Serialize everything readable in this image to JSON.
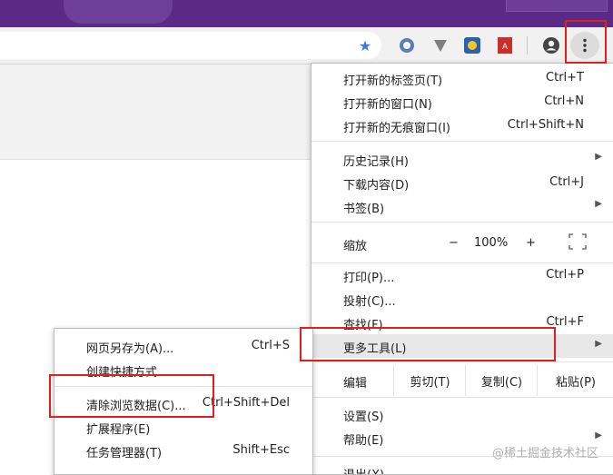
{
  "toolbar": {
    "icons": [
      "star-icon",
      "extension-icon-1",
      "extension-icon-2",
      "extension-icon-3",
      "pdf-icon",
      "account-icon",
      "kebab-menu-icon"
    ],
    "star_color": "#3b78e7"
  },
  "menu": {
    "new_tab": {
      "label": "打开新的标签页(T)",
      "shortcut": "Ctrl+T"
    },
    "new_window": {
      "label": "打开新的窗口(N)",
      "shortcut": "Ctrl+N"
    },
    "new_incognito": {
      "label": "打开新的无痕窗口(I)",
      "shortcut": "Ctrl+Shift+N"
    },
    "history": {
      "label": "历史记录(H)"
    },
    "downloads": {
      "label": "下载内容(D)",
      "shortcut": "Ctrl+J"
    },
    "bookmarks": {
      "label": "书签(B)"
    },
    "zoom": {
      "label": "缩放",
      "minus": "−",
      "value": "100%",
      "plus": "+"
    },
    "print": {
      "label": "打印(P)...",
      "shortcut": "Ctrl+P"
    },
    "cast": {
      "label": "投射(C)..."
    },
    "find": {
      "label": "查找(F)...",
      "shortcut": "Ctrl+F"
    },
    "more_tools": {
      "label": "更多工具(L)"
    },
    "edit": {
      "label": "编辑",
      "cut": "剪切(T)",
      "copy": "复制(C)",
      "paste": "粘贴(P)"
    },
    "settings": {
      "label": "设置(S)"
    },
    "help": {
      "label": "帮助(E)"
    },
    "exit": {
      "label": "退出(X)"
    }
  },
  "submenu": {
    "save_page": {
      "label": "网页另存为(A)...",
      "shortcut": "Ctrl+S"
    },
    "create_shortcut": {
      "label": "创建快捷方式..."
    },
    "clear_data": {
      "label": "清除浏览数据(C)...",
      "shortcut": "Ctrl+Shift+Del"
    },
    "extensions": {
      "label": "扩展程序(E)"
    },
    "task_manager": {
      "label": "任务管理器(T)",
      "shortcut": "Shift+Esc"
    }
  },
  "watermark": "@稀土掘金技术社区",
  "highlight_color": "#e02020"
}
